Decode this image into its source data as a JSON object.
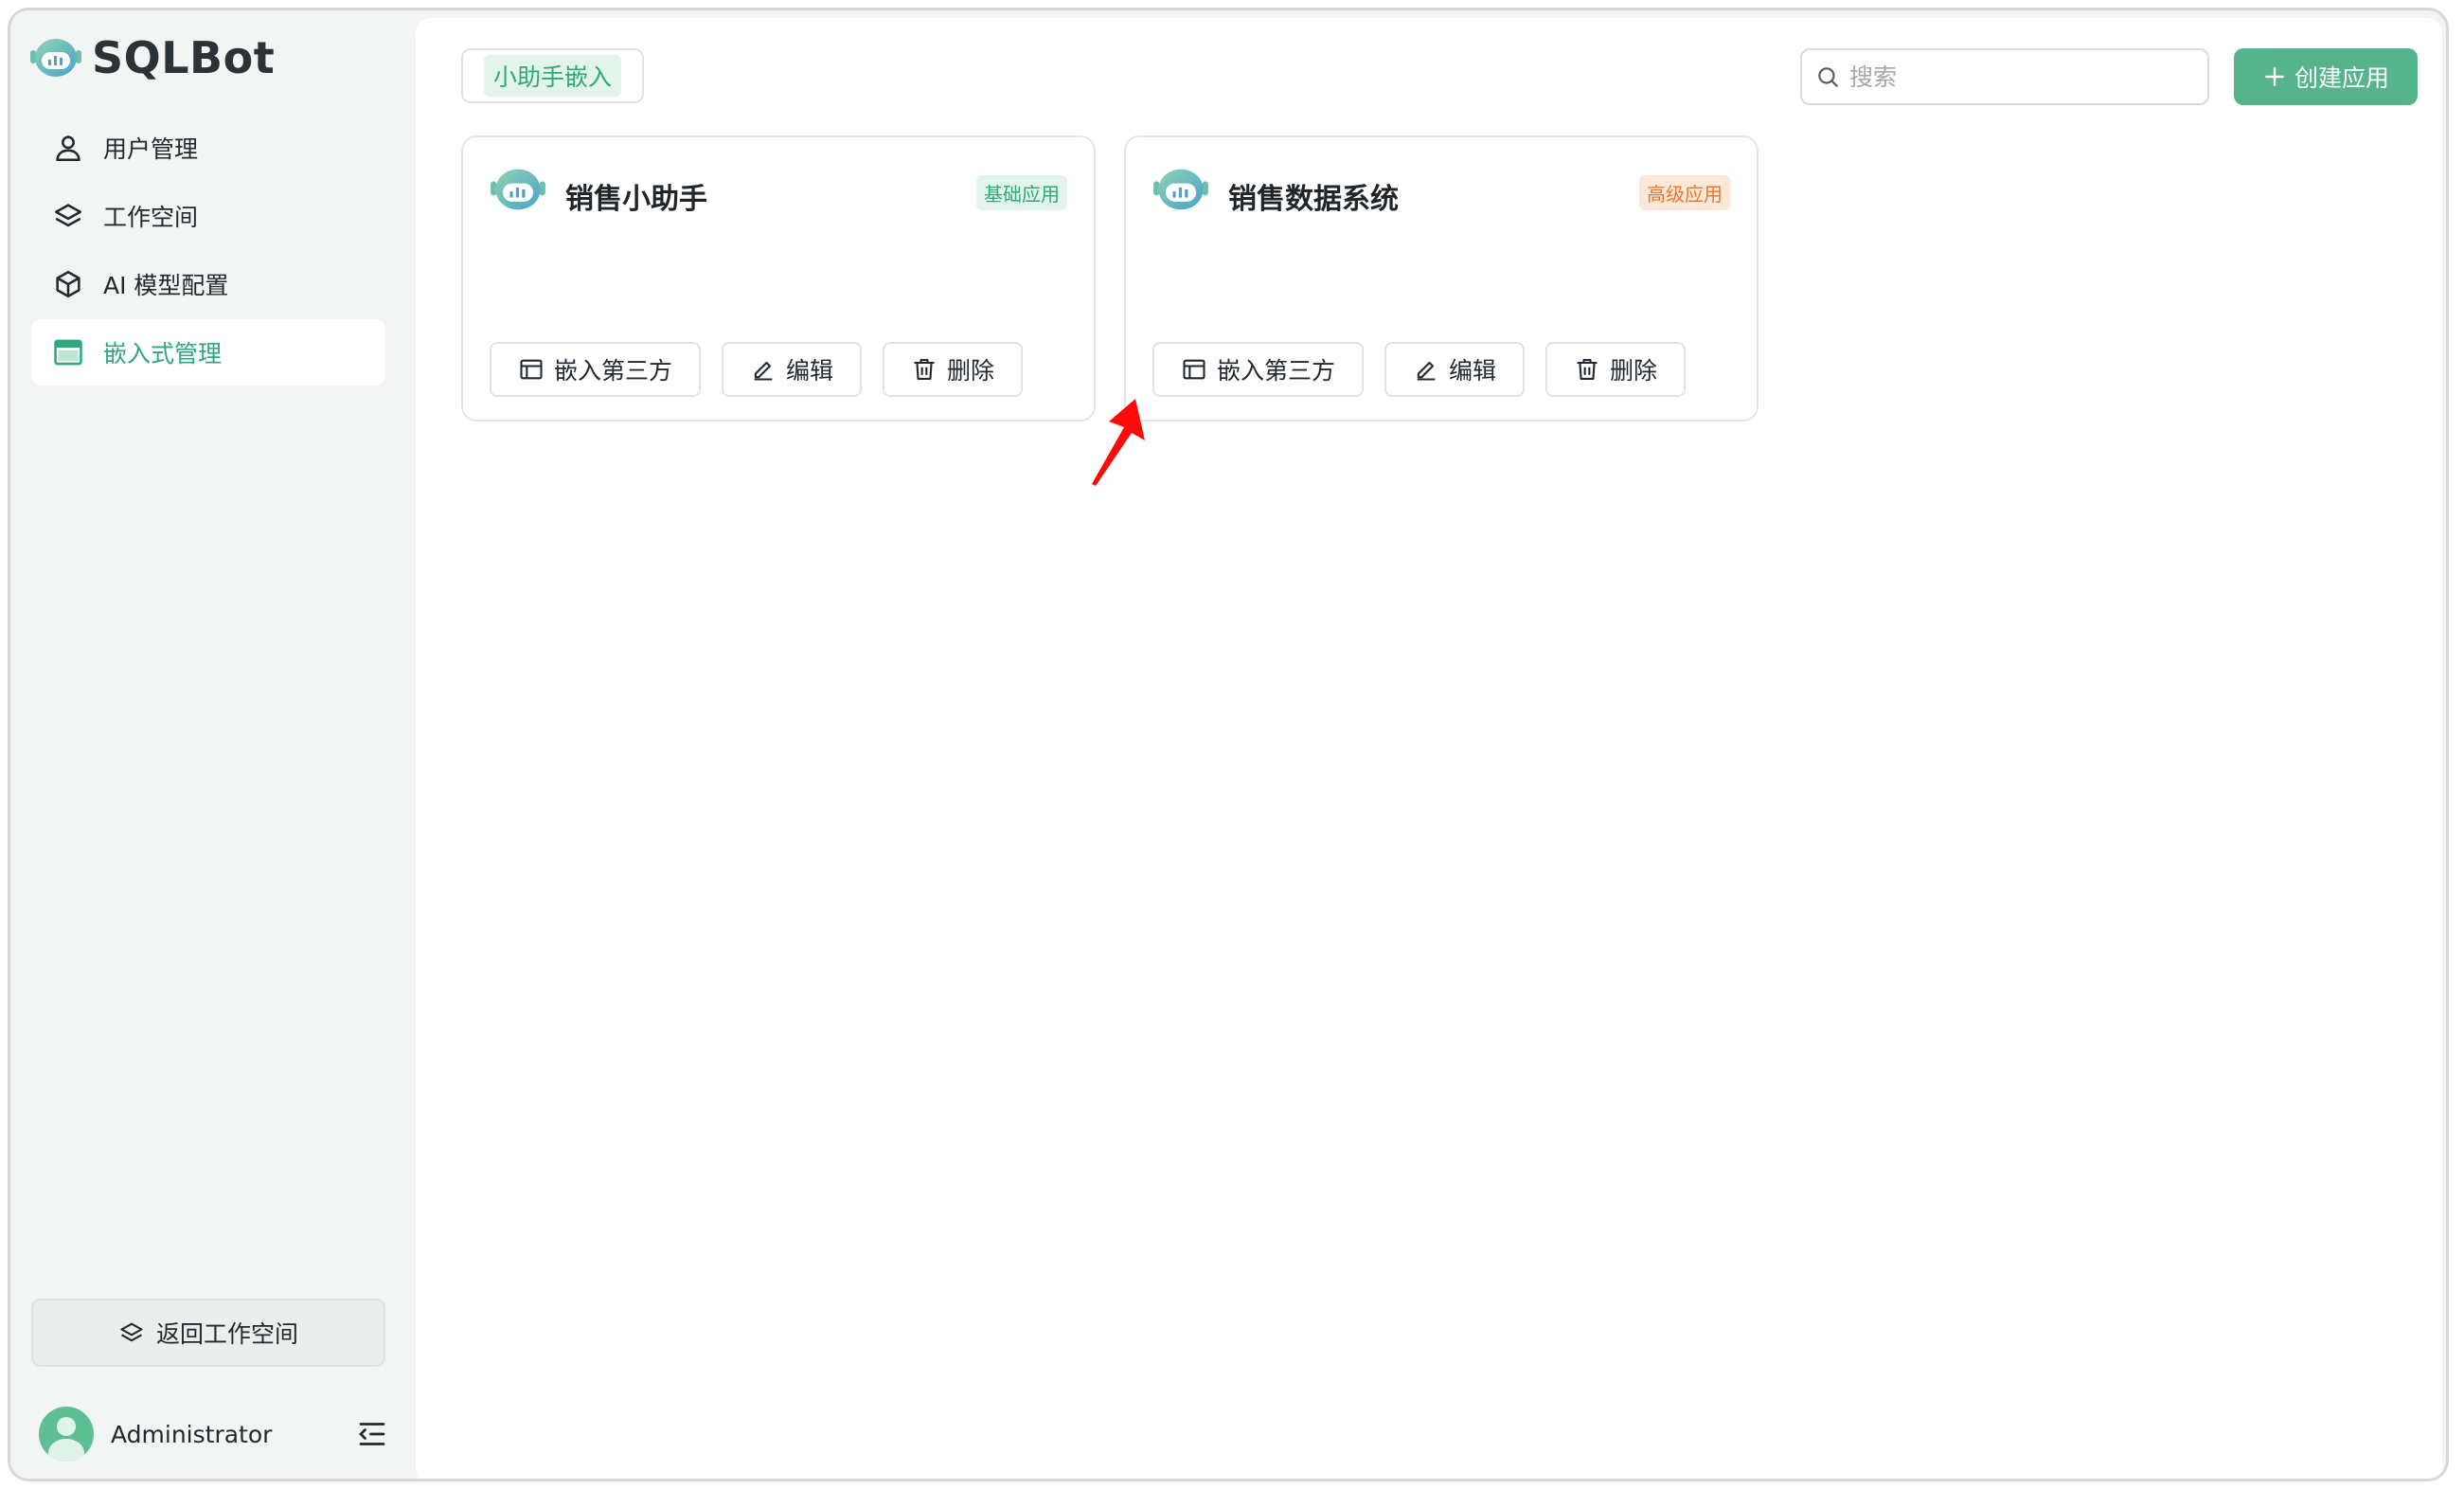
{
  "app": {
    "name": "SQLBot"
  },
  "sidebar": {
    "items": [
      {
        "label": "用户管理",
        "icon": "user-icon",
        "active": false
      },
      {
        "label": "工作空间",
        "icon": "layers-icon",
        "active": false
      },
      {
        "label": "AI 模型配置",
        "icon": "cube-icon",
        "active": false
      },
      {
        "label": "嵌入式管理",
        "icon": "window-icon",
        "active": true
      }
    ],
    "back_label": "返回工作空间",
    "user_name": "Administrator"
  },
  "toolbar": {
    "tab_label": "小助手嵌入",
    "search_placeholder": "搜索",
    "create_label": "创建应用"
  },
  "cards": [
    {
      "title": "销售小助手",
      "badge": "基础应用",
      "actions": {
        "embed": "嵌入第三方",
        "edit": "编辑",
        "delete": "删除"
      }
    },
    {
      "title": "销售数据系统",
      "badge": "高级应用",
      "actions": {
        "embed": "嵌入第三方",
        "edit": "编辑",
        "delete": "删除"
      }
    }
  ],
  "colors": {
    "accent": "#55b48b",
    "active_text": "#2ea87c",
    "advanced_badge": "#e8782e",
    "annotation_arrow": "#ff0000"
  }
}
